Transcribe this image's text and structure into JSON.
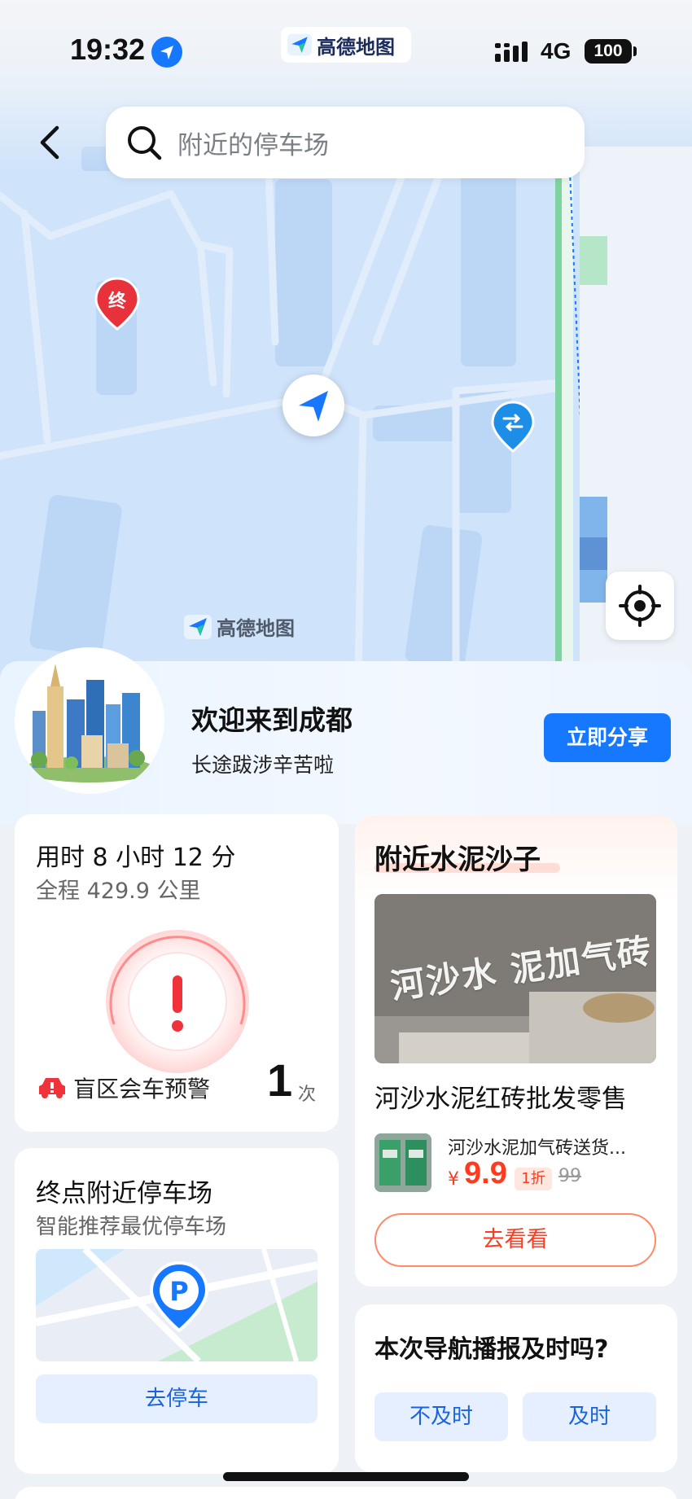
{
  "status_bar": {
    "time": "19:32",
    "app_name": "高德地图",
    "network": "4G",
    "battery": "100"
  },
  "search": {
    "placeholder": "附近的停车场"
  },
  "map": {
    "end_marker": "终",
    "logo_text": "高德地图"
  },
  "welcome": {
    "title": "欢迎来到成都",
    "subtitle": "长途跋涉辛苦啦",
    "share_button": "立即分享"
  },
  "trip": {
    "duration": "用时 8 小时 12 分",
    "distance": "全程 429.9 公里",
    "warning_label": "盲区会车预警",
    "warning_count": "1",
    "warning_unit": "次"
  },
  "parking": {
    "title": "终点附近停车场",
    "subtitle": "智能推荐最优停车场",
    "button": "去停车"
  },
  "ad": {
    "title": "附近水泥沙子",
    "image_text": "河沙水 泥加气砖",
    "headline": "河沙水泥红砖批发零售",
    "item_name": "河沙水泥加气砖送货...",
    "price_symbol": "¥",
    "price": "9.9",
    "discount": "1折",
    "original_price": "99",
    "button": "去看看"
  },
  "survey": {
    "question": "本次导航播报及时吗?",
    "no_button": "不及时",
    "yes_button": "及时"
  },
  "colors": {
    "accent": "#1677ff",
    "map_bg": "#cfe3fb",
    "price": "#ff3b1f",
    "end_marker": "#e8323b",
    "metro": "#1c8ee8"
  }
}
